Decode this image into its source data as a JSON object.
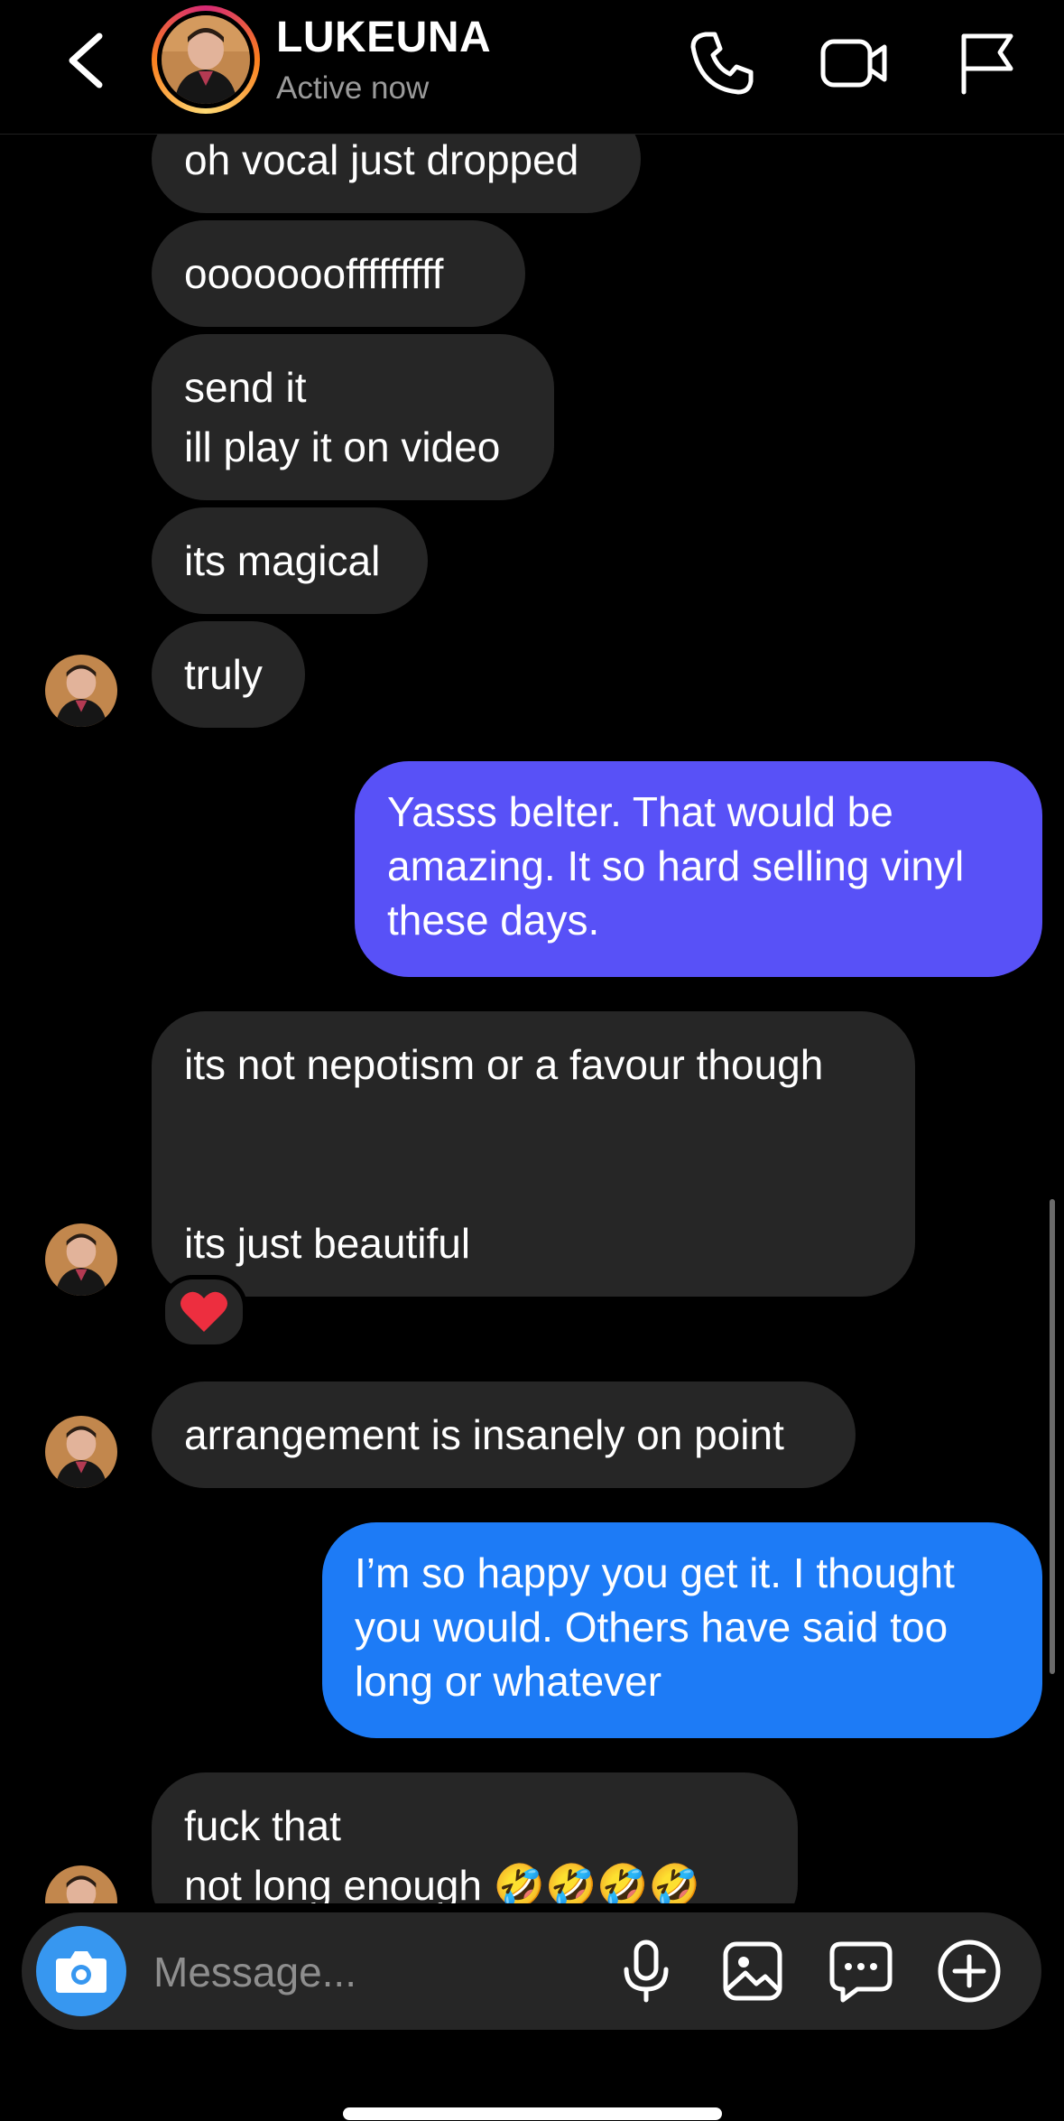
{
  "header": {
    "contact_name": "LUKEUNA",
    "status": "Active now",
    "icons": [
      "back-chevron-icon",
      "phone-icon",
      "video-camera-icon",
      "flag-icon"
    ]
  },
  "messages": [
    {
      "from": "them",
      "text": "oh vocal just dropped"
    },
    {
      "from": "them",
      "text": "ooooooofffffffff"
    },
    {
      "from": "them",
      "text": "send it\nill play it on video"
    },
    {
      "from": "them",
      "text": "its magical"
    },
    {
      "from": "them",
      "text": "truly"
    },
    {
      "from": "me",
      "text": "Yasss belter. That would be amazing. It so hard selling vinyl these days."
    },
    {
      "from": "them",
      "text": "its not nepotism or a favour though\n\n\nits just beautiful",
      "reaction": "❤️"
    },
    {
      "from": "them",
      "text": "arrangement is insanely on point"
    },
    {
      "from": "me",
      "text": "I’m so happy you get it. I thought you would. Others have said too long or whatever"
    },
    {
      "from": "them",
      "text": "fuck that\nnot long enough 🤣🤣🤣🤣"
    }
  ],
  "colors": {
    "incoming_bubble": "#262626",
    "outgoing_gradient_top": "#5851f7",
    "outgoing_gradient_bottom": "#1d7bf6",
    "camera_button": "#3797f0"
  },
  "composer": {
    "placeholder": "Message...",
    "icons": [
      "camera-icon",
      "microphone-icon",
      "gallery-icon",
      "sticker-icon",
      "plus-icon"
    ]
  }
}
